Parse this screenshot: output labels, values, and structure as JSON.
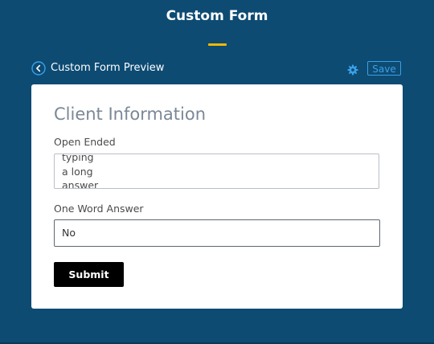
{
  "app": {
    "title": "Custom Form",
    "accent_color": "#f5b800",
    "background_color": "#0d4b73"
  },
  "preview_header": {
    "back_icon": "chevron-left-circle-icon",
    "title": "Custom Form Preview",
    "settings_icon": "gear-icon",
    "save_label": "Save",
    "link_color": "#3aa0e6"
  },
  "form": {
    "title": "Client Information",
    "fields": [
      {
        "label": "Open Ended",
        "type": "textarea",
        "value": "typing\na long\nanswer"
      },
      {
        "label": "One Word Answer",
        "type": "text",
        "value": "No"
      }
    ],
    "submit_label": "Submit"
  }
}
